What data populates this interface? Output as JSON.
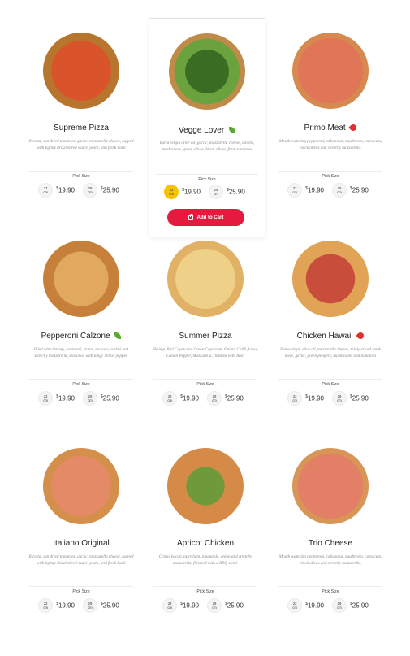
{
  "menu": {
    "pick_size_label": "Pick Size",
    "add_to_cart_label": "Add to Cart",
    "sizes": [
      {
        "num": "22",
        "unit": "cm",
        "price": "19.90"
      },
      {
        "num": "29",
        "unit": "cm",
        "price": "25.90"
      }
    ],
    "currency": "$",
    "pizzas": [
      {
        "name": "Supreme Pizza",
        "desc": "Ricotta, sun dried tomatoes, garlic, mozzarella cheese, topped with lightly drizzled red sauce, pesto, and fresh basil",
        "tag": "",
        "selected": false
      },
      {
        "name": "Vegge Lover",
        "desc": "Extra-virgin olive oil, garlic, mozzarella cheese, onions, mushrooms, green olives, black olives, fresh tomatoes",
        "tag": "leaf-icon",
        "selected": true
      },
      {
        "name": "Primo Meat",
        "desc": "Mouth watering pepperoni, cabanossi, mushroom, capsicum, black olives and stretchy mozzarella.",
        "tag": "chili-icon",
        "selected": false
      },
      {
        "name": "Pepperoni Calzone",
        "desc": "Piled with shrimp, calamari, clams, mussels, surimi and stretchy mozzarella, seasoned with tangy lemon pepper.",
        "tag": "leaf-icon",
        "selected": false
      },
      {
        "name": "Summer Pizza",
        "desc": "Shrimp, Red Capsicum, Green Capsicum, Onion, Chilli flakes, Lemon Pepper, Mozzarella, finished with Aioli",
        "tag": "",
        "selected": false
      },
      {
        "name": "Chicken Hawaii",
        "desc": "Extra-virgin olive oil, mozzarella cheese, thinly-sliced steak meat, garlic, green peppers, mushrooms and tomatoes",
        "tag": "chili-icon",
        "selected": false
      },
      {
        "name": "Italiano Original",
        "desc": "Ricotta, sun dried tomatoes, garlic, mozzarella cheese, topped with lightly drizzled red sauce, pesto, and fresh basil",
        "tag": "",
        "selected": false
      },
      {
        "name": "Apricot Chicken",
        "desc": "Crispy bacon, tasty ham, pineapple, onion and stretchy mozzarella, finished with a BBQ swirl.",
        "tag": "",
        "selected": false
      },
      {
        "name": "Trio Cheese",
        "desc": "Mouth watering pepperoni, cabanossi, mushroom, capsicum, black olives and stretchy mozzarella.",
        "tag": "",
        "selected": false
      }
    ]
  }
}
